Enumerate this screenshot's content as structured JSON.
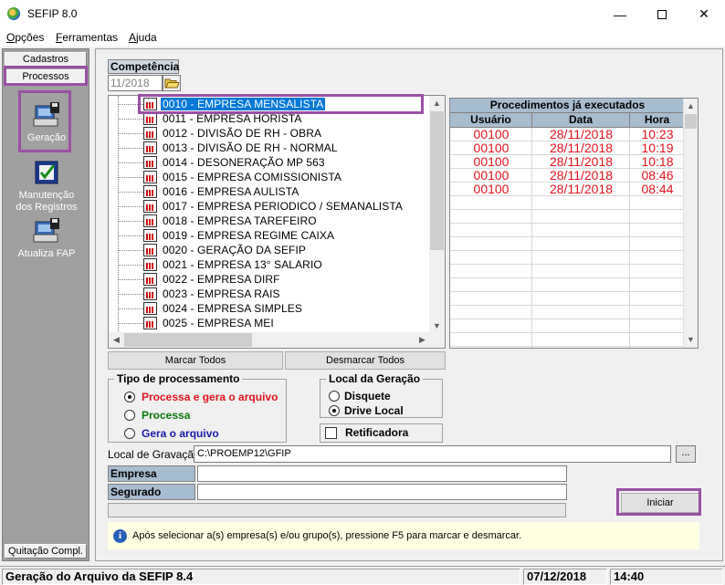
{
  "window": {
    "title": "SEFIP 8.0"
  },
  "menu": {
    "items": [
      "Opções",
      "Ferramentas",
      "Ajuda"
    ],
    "underline_first": [
      "O",
      "F",
      "A"
    ],
    "rest": [
      "pções",
      "erramentas",
      "juda"
    ]
  },
  "sidebar": {
    "tabs": {
      "cadastros": "Cadastros",
      "processos": "Processos",
      "quitacao": "Quitação Compl."
    },
    "buttons": {
      "geracao": "Geração",
      "manutencao_1": "Manutenção",
      "manutencao_2": "dos Registros",
      "atualiza": "Atualiza FAP"
    }
  },
  "competencia": {
    "label": "Competência",
    "value": "11/2018"
  },
  "tree": {
    "items": [
      "0010 - EMPRESA MENSALISTA",
      "0011 - EMPRESA HORISTA",
      "0012 - DIVISÃO DE RH - OBRA",
      "0013 - DIVISÃO DE RH - NORMAL",
      "0014 - DESONERAÇÃO MP 563",
      "0015 - EMPRESA COMISSIONISTA",
      "0016 - EMPRESA AULISTA",
      "0017 - EMPRESA PERIODICO / SEMANALISTA",
      "0018 - EMPRESA TAREFEIRO",
      "0019 - EMPRESA REGIME CAIXA",
      "0020 - GERAÇÃO DA SEFIP",
      "0021 - EMPRESA 13° SALARIO",
      "0022 - EMPRESA DIRF",
      "0023 - EMPRESA RAIS",
      "0024 - EMPRESA SIMPLES",
      "0025 - EMPRESA MEI"
    ]
  },
  "buttons": {
    "marcar": "Marcar Todos",
    "desmarcar": "Desmarcar Todos",
    "iniciar": "Iniciar",
    "browse": "..."
  },
  "procedimentos": {
    "title": "Procedimentos já executados",
    "columns": [
      "Usuário",
      "Data",
      "Hora"
    ],
    "rows": [
      [
        "00100",
        "28/11/2018",
        "10:23"
      ],
      [
        "00100",
        "28/11/2018",
        "10:19"
      ],
      [
        "00100",
        "28/11/2018",
        "10:18"
      ],
      [
        "00100",
        "28/11/2018",
        "08:46"
      ],
      [
        "00100",
        "28/11/2018",
        "08:44"
      ]
    ]
  },
  "tipo": {
    "title": "Tipo de processamento",
    "options": [
      "Processa e gera o arquivo",
      "Processa",
      "Gera o arquivo"
    ],
    "colors": [
      "#e0141e",
      "#0a7a0a",
      "#1a1aa8"
    ],
    "selected": 0
  },
  "local": {
    "title": "Local da Geração",
    "options": [
      "Disquete",
      "Drive Local"
    ],
    "selected": 1,
    "retificadora": "Retificadora"
  },
  "gravacao": {
    "label": "Local de Gravação",
    "value": "C:\\PROEMP12\\GFIP"
  },
  "fields": {
    "empresa": "Empresa",
    "segurado": "Segurado"
  },
  "info": {
    "text": "Após selecionar a(s) empresa(s) e/ou grupo(s), pressione F5 para marcar e desmarcar."
  },
  "status": {
    "text": "Geração do Arquivo da SEFIP 8.4",
    "date": "07/12/2018",
    "time": "14:40"
  }
}
